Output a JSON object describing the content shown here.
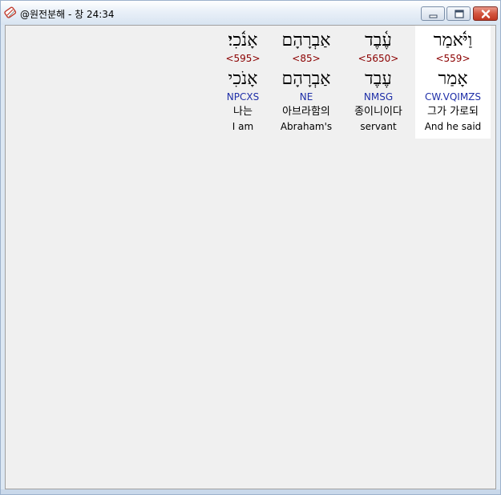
{
  "window": {
    "title": "@원전분해 - 창 24:34"
  },
  "words": [
    {
      "hebrew": "וַיֹּ֫אמַר",
      "strong": "<559>",
      "lemma": "אָמַר",
      "morph": "CW.VQIMZS",
      "korean": "그가 가로되",
      "english": "And he said",
      "selected": true
    },
    {
      "hebrew": "עֶ֫בֶד",
      "strong": "<5650>",
      "lemma": "עֶבֶד",
      "morph": "NMSG",
      "korean": "종이니이다",
      "english": "servant",
      "selected": false
    },
    {
      "hebrew": "אַבְרָהָם",
      "strong": "<85>",
      "lemma": "אַבְרָהָם",
      "morph": "NE",
      "korean": "아브라함의",
      "english": "Abraham's",
      "selected": false
    },
    {
      "hebrew": "אָנֹ֫כִי׃",
      "strong": "<595>",
      "lemma": "אָנֹכִי",
      "morph": "NPCXS",
      "korean": "나는",
      "english": "I am",
      "selected": false
    }
  ]
}
